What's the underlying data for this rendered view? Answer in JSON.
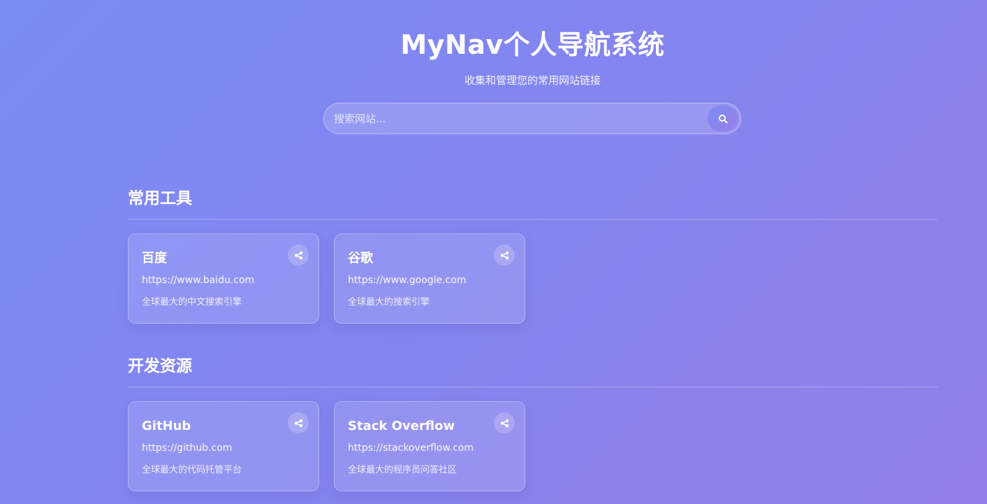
{
  "header": {
    "title": "MyNav个人导航系统",
    "subtitle": "收集和管理您的常用网站链接"
  },
  "search": {
    "placeholder": "搜索网站...",
    "value": "",
    "button_icon": "search-icon"
  },
  "sections": [
    {
      "title": "常用工具",
      "cards": [
        {
          "name": "百度",
          "url": "https://www.baidu.com",
          "description": "全球最大的中文搜索引擎",
          "action_icon": "share-icon"
        },
        {
          "name": "谷歌",
          "url": "https://www.google.com",
          "description": "全球最大的搜索引擎",
          "action_icon": "share-icon"
        }
      ]
    },
    {
      "title": "开发资源",
      "cards": [
        {
          "name": "GitHub",
          "url": "https://github.com",
          "description": "全球最大的代码托管平台",
          "action_icon": "share-icon"
        },
        {
          "name": "Stack Overflow",
          "url": "https://stackoverflow.com",
          "description": "全球最大的程序员问答社区",
          "action_icon": "share-icon"
        }
      ]
    }
  ],
  "colors": {
    "background_start": "#7a8cf6",
    "background_end": "#9380e8",
    "text": "#ffffff"
  }
}
